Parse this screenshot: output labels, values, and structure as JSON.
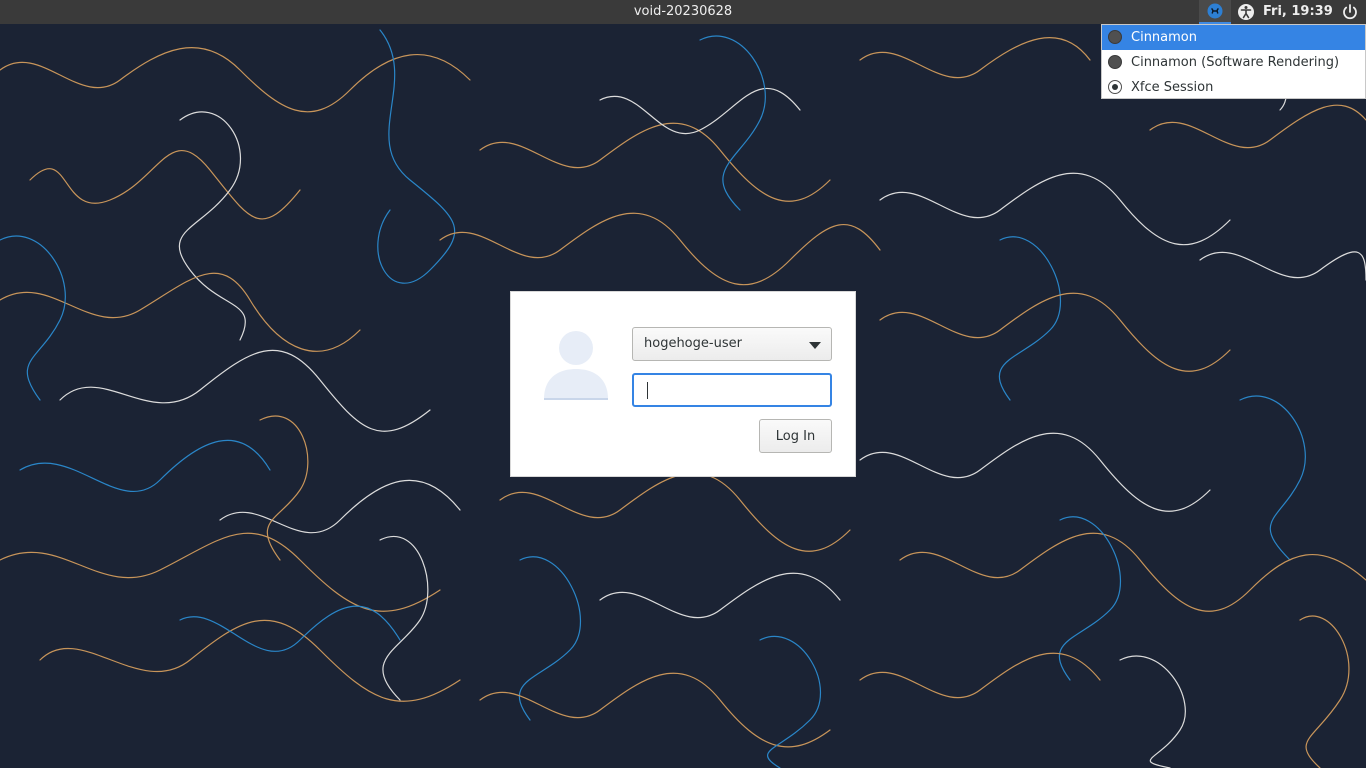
{
  "panel": {
    "hostname": "void-20230628",
    "clock": "Fri, 19:39"
  },
  "session_menu": {
    "items": [
      {
        "label": "Cinnamon",
        "selected": true,
        "checked": false
      },
      {
        "label": "Cinnamon (Software Rendering)",
        "selected": false,
        "checked": false
      },
      {
        "label": "Xfce Session",
        "selected": false,
        "checked": true
      }
    ]
  },
  "login": {
    "user": "hogehoge-user",
    "password_value": "",
    "login_button": "Log In"
  },
  "icons": {
    "session": "xfce-session-icon",
    "accessibility": "accessibility-icon",
    "power": "power-icon",
    "avatar": "default-avatar-icon",
    "dropdown": "chevron-down-icon"
  },
  "colors": {
    "panel": "#3a3a3a",
    "accent": "#3584e4",
    "wallpaper_bg": "#1b2334",
    "wallpaper_line_orange": "#c8955a",
    "wallpaper_line_blue": "#2a86c8",
    "wallpaper_line_white": "#dcdcdc"
  }
}
